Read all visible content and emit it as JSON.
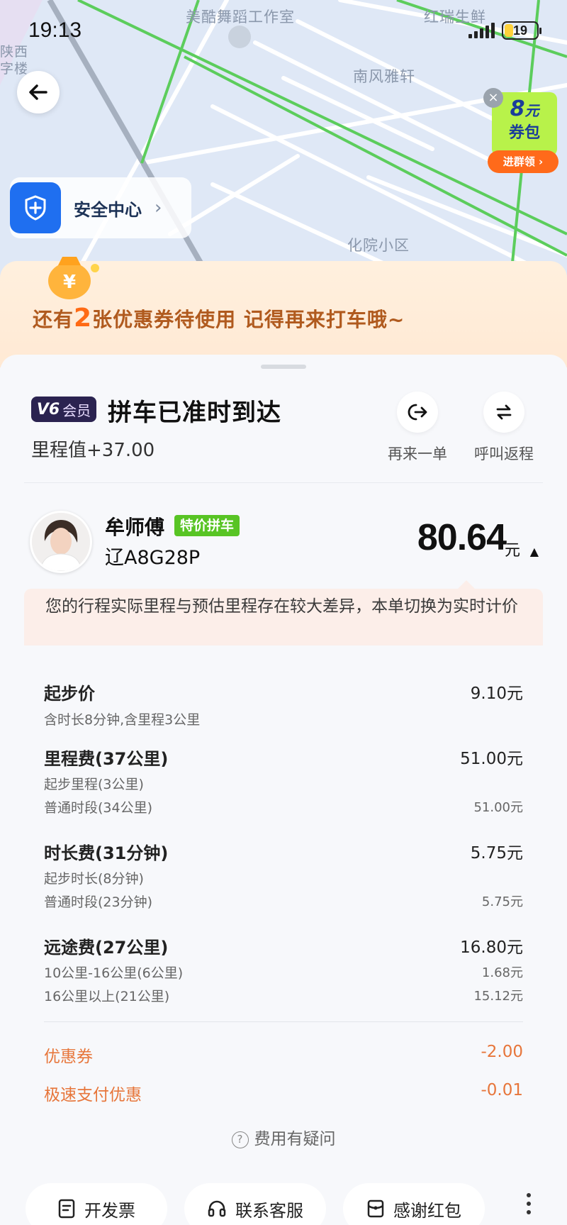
{
  "status_bar": {
    "time": "19:13",
    "battery": "19"
  },
  "map": {
    "labels": [
      "美酷舞蹈工作室",
      "红瑞生鲜",
      "南风雅轩",
      "化院小区",
      "陕西",
      "字楼"
    ]
  },
  "safety_center": {
    "label": "安全中心"
  },
  "coupon_ad": {
    "amount": "8",
    "amount_unit": "元",
    "line2": "券包",
    "button": "进群领 ›"
  },
  "promo": {
    "prefix": "还有",
    "count": "2",
    "suffix": "张优惠券待使用 记得再来打车哦~"
  },
  "trip": {
    "vip_level": "V6",
    "vip_label": "会员",
    "status": "拼车已准时到达",
    "mileage": "里程值+37.00",
    "actions": [
      {
        "label": "再来一单"
      },
      {
        "label": "呼叫返程"
      }
    ]
  },
  "driver": {
    "name": "牟师傅",
    "tag": "特价拼车",
    "plate": "辽A8G28P"
  },
  "price": {
    "total": "80.64",
    "unit": "元"
  },
  "notice": "您的行程实际里程与预估里程存在较大差异，本单切换为实时计价",
  "fees": {
    "base": {
      "label": "起步价",
      "value": "9.10元",
      "note": "含时长8分钟,含里程3公里"
    },
    "distance": {
      "label": "里程费(37公里)",
      "value": "51.00元",
      "subs": [
        {
          "label": "起步里程(3公里)",
          "value": ""
        },
        {
          "label": "普通时段(34公里)",
          "value": "51.00元"
        }
      ]
    },
    "duration": {
      "label": "时长费(31分钟)",
      "value": "5.75元",
      "subs": [
        {
          "label": "起步时长(8分钟)",
          "value": ""
        },
        {
          "label": "普通时段(23分钟)",
          "value": "5.75元"
        }
      ]
    },
    "long_distance": {
      "label": "远途费(27公里)",
      "value": "16.80元",
      "subs": [
        {
          "label": "10公里-16公里(6公里)",
          "value": "1.68元"
        },
        {
          "label": "16公里以上(21公里)",
          "value": "15.12元"
        }
      ]
    }
  },
  "discounts": [
    {
      "label": "优惠券",
      "value": "-2.00"
    },
    {
      "label": "极速支付优惠",
      "value": "-0.01"
    }
  ],
  "fee_question": "费用有疑问",
  "bottom_actions": [
    {
      "label": "开发票"
    },
    {
      "label": "联系客服"
    },
    {
      "label": "感谢红包"
    }
  ],
  "colors": {
    "accent_orange": "#e7763b",
    "tag_green": "#58c424",
    "shield_blue": "#1f6ff0",
    "vip_purple": "#2b2350"
  }
}
